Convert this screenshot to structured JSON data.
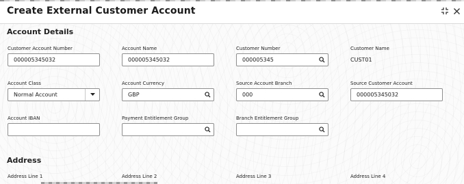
{
  "header": {
    "title": "Create External Customer Account"
  },
  "sections": {
    "account_details": "Account Details",
    "address": "Address"
  },
  "fields": {
    "customer_account_number": {
      "label": "Customer Account Number",
      "value": "000005345032"
    },
    "account_name": {
      "label": "Account Name",
      "value": "000005345032"
    },
    "customer_number": {
      "label": "Customer Number",
      "value": "000005345"
    },
    "customer_name": {
      "label": "Customer Name",
      "value": "CUST01"
    },
    "account_class": {
      "label": "Account Class",
      "value": "Normal Account"
    },
    "account_currency": {
      "label": "Account Currency",
      "value": "GBP"
    },
    "source_account_branch": {
      "label": "Source Account Branch",
      "value": "000"
    },
    "source_customer_account": {
      "label": "Source Customer Account",
      "value": "000005345032"
    },
    "account_iban": {
      "label": "Account IBAN",
      "value": ""
    },
    "payment_entitlement_group": {
      "label": "Payment Entitlement Group",
      "value": ""
    },
    "branch_entitlement_group": {
      "label": "Branch Entitlement Group",
      "value": ""
    }
  },
  "address": {
    "line1": "Address Line 1",
    "line2": "Address Line 2",
    "line3": "Address Line 3",
    "line4": "Address Line 4"
  },
  "icons": {
    "search": "search-icon",
    "dropdown": "caret-down-icon",
    "minimize": "collapse-icon",
    "close": "close-icon"
  }
}
